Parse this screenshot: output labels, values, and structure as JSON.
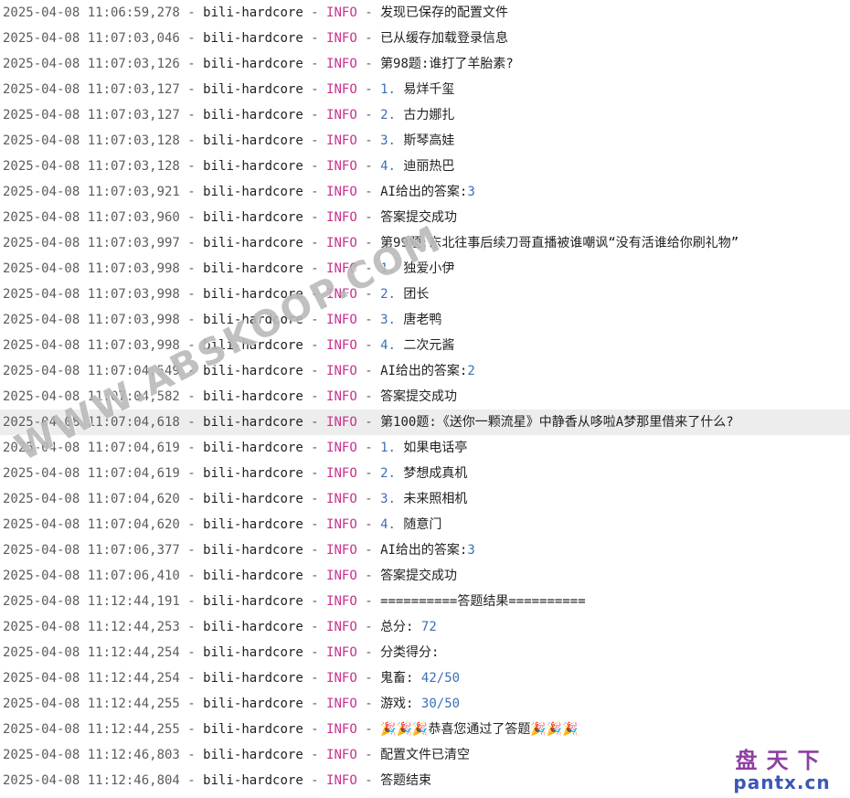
{
  "console": {
    "logger": "bili-hardcore",
    "separator": " - ",
    "lines": [
      {
        "ts": "2025-04-08 11:06:59,278",
        "level": "INFO",
        "msg": "发现已保存的配置文件",
        "num": ""
      },
      {
        "ts": "2025-04-08 11:07:03,046",
        "level": "INFO",
        "msg": "已从缓存加载登录信息",
        "num": ""
      },
      {
        "ts": "2025-04-08 11:07:03,126",
        "level": "INFO",
        "msg": "第98题:谁打了羊胎素?",
        "num": ""
      },
      {
        "ts": "2025-04-08 11:07:03,127",
        "level": "INFO",
        "msg": " 易烊千玺",
        "num": "1."
      },
      {
        "ts": "2025-04-08 11:07:03,127",
        "level": "INFO",
        "msg": " 古力娜扎",
        "num": "2."
      },
      {
        "ts": "2025-04-08 11:07:03,128",
        "level": "INFO",
        "msg": " 斯琴高娃",
        "num": "3."
      },
      {
        "ts": "2025-04-08 11:07:03,128",
        "level": "INFO",
        "msg": " 迪丽热巴",
        "num": "4."
      },
      {
        "ts": "2025-04-08 11:07:03,921",
        "level": "INFO",
        "msg": "AI给出的答案:",
        "num": "3",
        "num_after": true
      },
      {
        "ts": "2025-04-08 11:07:03,960",
        "level": "INFO",
        "msg": "答案提交成功",
        "num": ""
      },
      {
        "ts": "2025-04-08 11:07:03,997",
        "level": "INFO",
        "msg": "第99题:东北往事后续刀哥直播被谁嘲讽“没有活谁给你刷礼物”",
        "num": ""
      },
      {
        "ts": "2025-04-08 11:07:03,998",
        "level": "INFO",
        "msg": " 独爱小伊",
        "num": "1."
      },
      {
        "ts": "2025-04-08 11:07:03,998",
        "level": "INFO",
        "msg": " 团长",
        "num": "2."
      },
      {
        "ts": "2025-04-08 11:07:03,998",
        "level": "INFO",
        "msg": " 唐老鸭",
        "num": "3."
      },
      {
        "ts": "2025-04-08 11:07:03,998",
        "level": "INFO",
        "msg": " 二次元酱",
        "num": "4."
      },
      {
        "ts": "2025-04-08 11:07:04,549",
        "level": "INFO",
        "msg": "AI给出的答案:",
        "num": "2",
        "num_after": true
      },
      {
        "ts": "2025-04-08 11:07:04,582",
        "level": "INFO",
        "msg": "答案提交成功",
        "num": ""
      },
      {
        "ts": "2025-04-08 11:07:04,618",
        "level": "INFO",
        "msg": "第100题:《送你一颗流星》中静香从哆啦A梦那里借来了什么?",
        "num": "",
        "highlight": true
      },
      {
        "ts": "2025-04-08 11:07:04,619",
        "level": "INFO",
        "msg": " 如果电话亭",
        "num": "1."
      },
      {
        "ts": "2025-04-08 11:07:04,619",
        "level": "INFO",
        "msg": " 梦想成真机",
        "num": "2."
      },
      {
        "ts": "2025-04-08 11:07:04,620",
        "level": "INFO",
        "msg": " 未来照相机",
        "num": "3."
      },
      {
        "ts": "2025-04-08 11:07:04,620",
        "level": "INFO",
        "msg": " 随意门",
        "num": "4."
      },
      {
        "ts": "2025-04-08 11:07:06,377",
        "level": "INFO",
        "msg": "AI给出的答案:",
        "num": "3",
        "num_after": true
      },
      {
        "ts": "2025-04-08 11:07:06,410",
        "level": "INFO",
        "msg": "答案提交成功",
        "num": ""
      },
      {
        "ts": "2025-04-08 11:12:44,191",
        "level": "INFO",
        "msg": "==========答题结果==========",
        "num": ""
      },
      {
        "ts": "2025-04-08 11:12:44,253",
        "level": "INFO",
        "msg": "总分: ",
        "num": "72",
        "num_after": true
      },
      {
        "ts": "2025-04-08 11:12:44,254",
        "level": "INFO",
        "msg": "分类得分:",
        "num": ""
      },
      {
        "ts": "2025-04-08 11:12:44,254",
        "level": "INFO",
        "msg": "鬼畜: ",
        "num": "42/50",
        "num_after": true
      },
      {
        "ts": "2025-04-08 11:12:44,255",
        "level": "INFO",
        "msg": "游戏: ",
        "num": "30/50",
        "num_after": true
      },
      {
        "ts": "2025-04-08 11:12:44,255",
        "level": "INFO",
        "msg": "🎉🎉🎉恭喜您通过了答题🎉🎉🎉",
        "num": ""
      },
      {
        "ts": "2025-04-08 11:12:46,803",
        "level": "INFO",
        "msg": "配置文件已清空",
        "num": ""
      },
      {
        "ts": "2025-04-08 11:12:46,804",
        "level": "INFO",
        "msg": "答题结束",
        "num": ""
      }
    ]
  },
  "watermark": "WWW.ABSKOOP.COM",
  "brand": {
    "cn": "盘天下",
    "en": "pantx.cn"
  },
  "colors": {
    "level": "#c7318d",
    "number": "#3c6fb6",
    "highlight_row": "#ededed"
  }
}
